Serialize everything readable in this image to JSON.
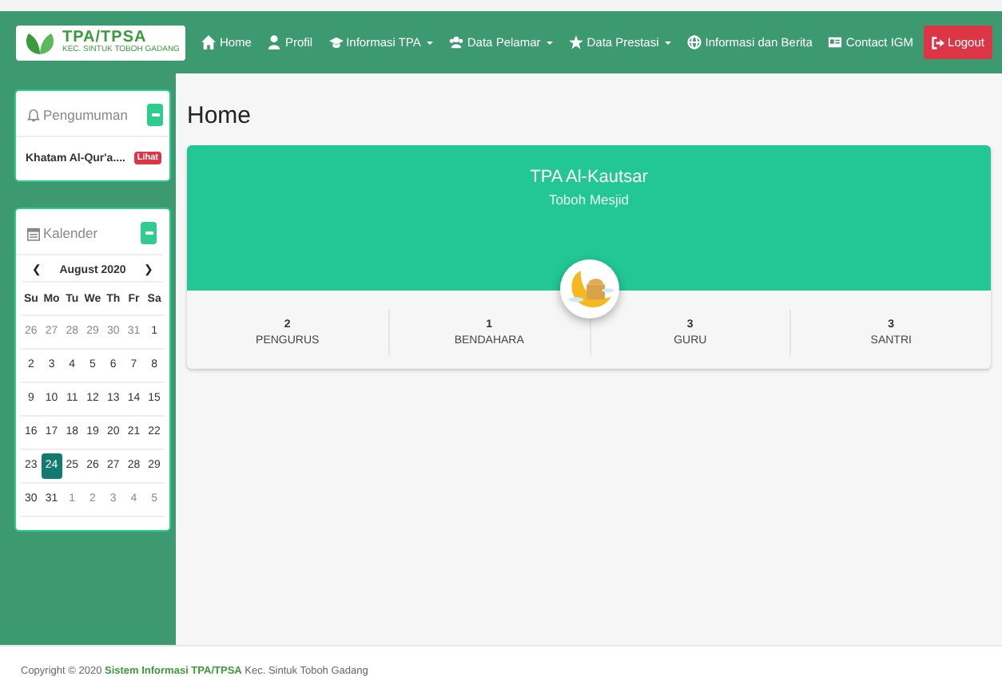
{
  "navbar": {
    "logo_text": "TPA/TPSA",
    "logo_subtext": "KEC. SINTUK TOBOH GADANG",
    "items": [
      {
        "label": "Home",
        "dropdown": false
      },
      {
        "label": "Profil",
        "dropdown": false
      },
      {
        "label": "Informasi TPA",
        "dropdown": true
      },
      {
        "label": "Data Pelamar",
        "dropdown": true
      },
      {
        "label": "Data Prestasi",
        "dropdown": true
      },
      {
        "label": "Informasi dan Berita",
        "dropdown": false
      },
      {
        "label": "Contact IGM",
        "dropdown": false
      }
    ],
    "logout": "Logout"
  },
  "sidebar": {
    "announcement": {
      "title": "Pengumuman",
      "item": "Khatam Al-Qur'a....",
      "badge": "Lihat"
    },
    "calendar": {
      "title": "Kalender",
      "prev": "❮",
      "month": "August 2020",
      "next": "❯",
      "weekdays": [
        "Su",
        "Mo",
        "Tu",
        "We",
        "Th",
        "Fr",
        "Sa"
      ],
      "weeks": [
        [
          {
            "day": "26",
            "muted": true,
            "selected": false
          },
          {
            "day": "27",
            "muted": true,
            "selected": false
          },
          {
            "day": "28",
            "muted": true,
            "selected": false
          },
          {
            "day": "29",
            "muted": true,
            "selected": false
          },
          {
            "day": "30",
            "muted": true,
            "selected": false
          },
          {
            "day": "31",
            "muted": true,
            "selected": false
          },
          {
            "day": "1",
            "muted": false,
            "selected": false
          }
        ],
        [
          {
            "day": "2",
            "muted": false,
            "selected": false
          },
          {
            "day": "3",
            "muted": false,
            "selected": false
          },
          {
            "day": "4",
            "muted": false,
            "selected": false
          },
          {
            "day": "5",
            "muted": false,
            "selected": false
          },
          {
            "day": "6",
            "muted": false,
            "selected": false
          },
          {
            "day": "7",
            "muted": false,
            "selected": false
          },
          {
            "day": "8",
            "muted": false,
            "selected": false
          }
        ],
        [
          {
            "day": "9",
            "muted": false,
            "selected": false
          },
          {
            "day": "10",
            "muted": false,
            "selected": false
          },
          {
            "day": "11",
            "muted": false,
            "selected": false
          },
          {
            "day": "12",
            "muted": false,
            "selected": false
          },
          {
            "day": "13",
            "muted": false,
            "selected": false
          },
          {
            "day": "14",
            "muted": false,
            "selected": false
          },
          {
            "day": "15",
            "muted": false,
            "selected": false
          }
        ],
        [
          {
            "day": "16",
            "muted": false,
            "selected": false
          },
          {
            "day": "17",
            "muted": false,
            "selected": false
          },
          {
            "day": "18",
            "muted": false,
            "selected": false
          },
          {
            "day": "19",
            "muted": false,
            "selected": false
          },
          {
            "day": "20",
            "muted": false,
            "selected": false
          },
          {
            "day": "21",
            "muted": false,
            "selected": false
          },
          {
            "day": "22",
            "muted": false,
            "selected": false
          }
        ],
        [
          {
            "day": "23",
            "muted": false,
            "selected": false
          },
          {
            "day": "24",
            "muted": false,
            "selected": true
          },
          {
            "day": "25",
            "muted": false,
            "selected": false
          },
          {
            "day": "26",
            "muted": false,
            "selected": false
          },
          {
            "day": "27",
            "muted": false,
            "selected": false
          },
          {
            "day": "28",
            "muted": false,
            "selected": false
          },
          {
            "day": "29",
            "muted": false,
            "selected": false
          }
        ],
        [
          {
            "day": "30",
            "muted": false,
            "selected": false
          },
          {
            "day": "31",
            "muted": false,
            "selected": false
          },
          {
            "day": "1",
            "muted": true,
            "selected": false
          },
          {
            "day": "2",
            "muted": true,
            "selected": false
          },
          {
            "day": "3",
            "muted": true,
            "selected": false
          },
          {
            "day": "4",
            "muted": true,
            "selected": false
          },
          {
            "day": "5",
            "muted": true,
            "selected": false
          }
        ]
      ]
    }
  },
  "main": {
    "heading": "Home",
    "profile": {
      "name": "TPA Al-Kautsar",
      "location": "Toboh Mesjid"
    },
    "stats": [
      {
        "value": "2",
        "label": "PENGURUS"
      },
      {
        "value": "1",
        "label": "BENDAHARA"
      },
      {
        "value": "3",
        "label": "GURU"
      },
      {
        "value": "3",
        "label": "SANTRI"
      }
    ]
  },
  "footer": {
    "text": "Copyright © 2020 **Sistem Informasi TPA/TPSA** Kec. Sintuk Toboh Gadang"
  }
}
